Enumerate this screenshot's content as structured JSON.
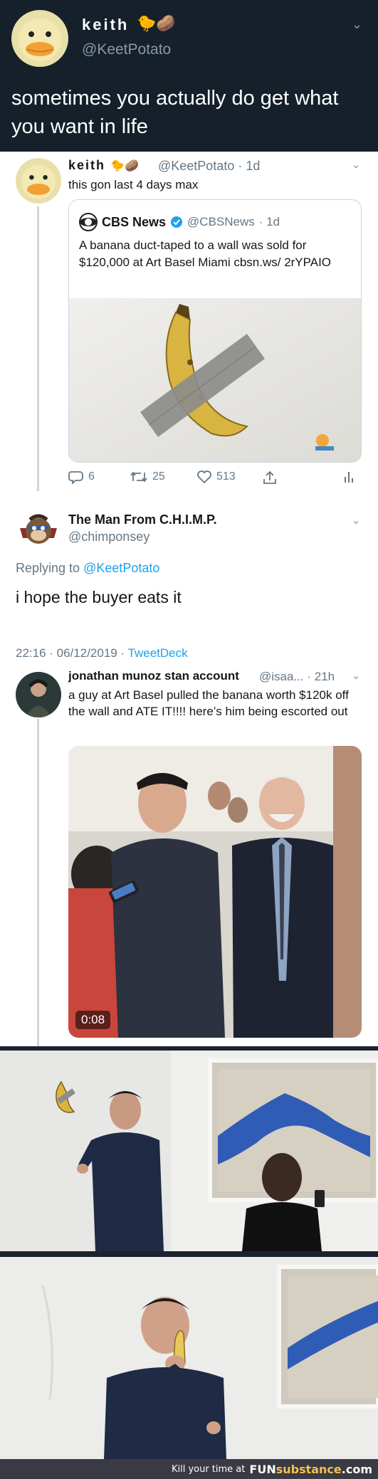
{
  "top_tweet": {
    "name": "keith",
    "name_emojis": "🐤🥔",
    "handle": "@KeetPotato",
    "text": "sometimes you actually do get what you want in life"
  },
  "reply_tweet": {
    "name": "keith",
    "name_emojis": "🐤🥔",
    "handle": "@KeetPotato",
    "time": "· 1d",
    "text": "this gon last 4 days max",
    "quote": {
      "name": "CBS News",
      "handle": "@CBSNews",
      "time": "· 1d",
      "text": "A banana duct-taped to a wall was sold for $120,000 at Art Basel Miami cbsn.ws/ 2rYPAIO"
    },
    "actions": {
      "replies": "6",
      "retweets": "25",
      "likes": "513"
    }
  },
  "chimp_tweet": {
    "name": "The Man From C.H.I.M.P.",
    "handle": "@chimponsey",
    "replying_prefix": "Replying to ",
    "replying_to": "@KeetPotato",
    "text": "i hope the buyer eats it",
    "timestamp": "22:16 · 06/12/2019 · ",
    "source": "TweetDeck"
  },
  "jonathan_tweet": {
    "name": "jonathan munoz stan account",
    "handle": "@isaa...",
    "time": "· 21h",
    "text": "a guy at Art Basel pulled the banana worth $120k off the wall and ATE IT!!!! here’s him being escorted out",
    "video_duration": "0:08"
  },
  "footer": {
    "tagline": "Kill your time at",
    "brand_main": "FUN",
    "brand_sub": "substance",
    "brand_tld": ".com"
  },
  "colors": {
    "dark_bg": "#15202b",
    "accent": "#1da1f2",
    "muted": "#657786"
  }
}
